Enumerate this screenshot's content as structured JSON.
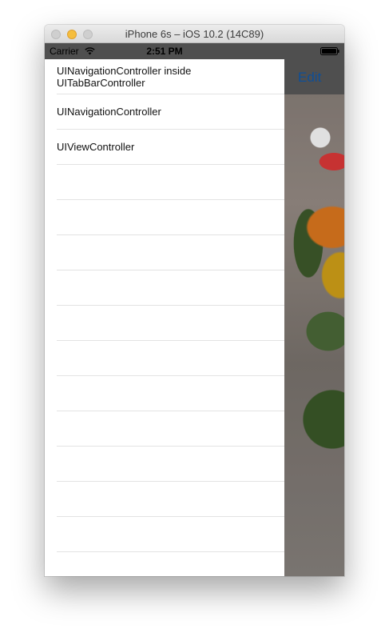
{
  "window": {
    "title": "iPhone 6s – iOS 10.2 (14C89)"
  },
  "status_bar": {
    "carrier": "Carrier",
    "time": "2:51 PM"
  },
  "nav": {
    "edit_label": "Edit"
  },
  "menu": {
    "items": [
      {
        "label": "UINavigationController inside UITabBarController"
      },
      {
        "label": "UINavigationController"
      },
      {
        "label": "UIViewController"
      }
    ],
    "empty_row_count": 12
  },
  "colors": {
    "accent": "#0e4f97",
    "separator": "#e3e3e3"
  }
}
